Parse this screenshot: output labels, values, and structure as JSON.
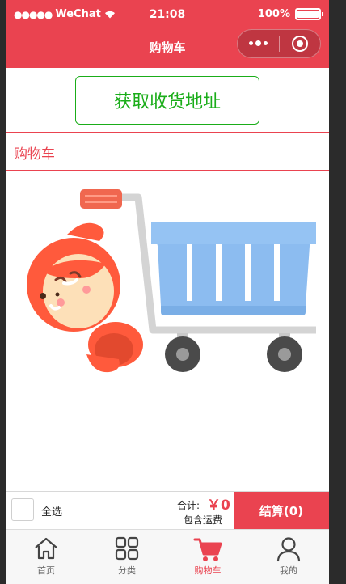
{
  "status_bar": {
    "carrier": "WeChat",
    "time": "21:08",
    "battery": "100%"
  },
  "nav": {
    "title": "购物车"
  },
  "address": {
    "button_label": "获取收货地址"
  },
  "cart": {
    "section_title": "购物车"
  },
  "footer": {
    "select_all": "全选",
    "total_label": "合计:",
    "total_price": "￥0",
    "freight_note": "包含运费",
    "checkout_label": "结算(0)"
  },
  "tabbar": {
    "items": [
      {
        "label": "首页",
        "icon": "home-icon"
      },
      {
        "label": "分类",
        "icon": "grid-icon"
      },
      {
        "label": "购物车",
        "icon": "cart-icon"
      },
      {
        "label": "我的",
        "icon": "user-icon"
      }
    ],
    "active_index": 2
  },
  "colors": {
    "brand_red": "#ea4350",
    "address_green": "#1aad19"
  }
}
